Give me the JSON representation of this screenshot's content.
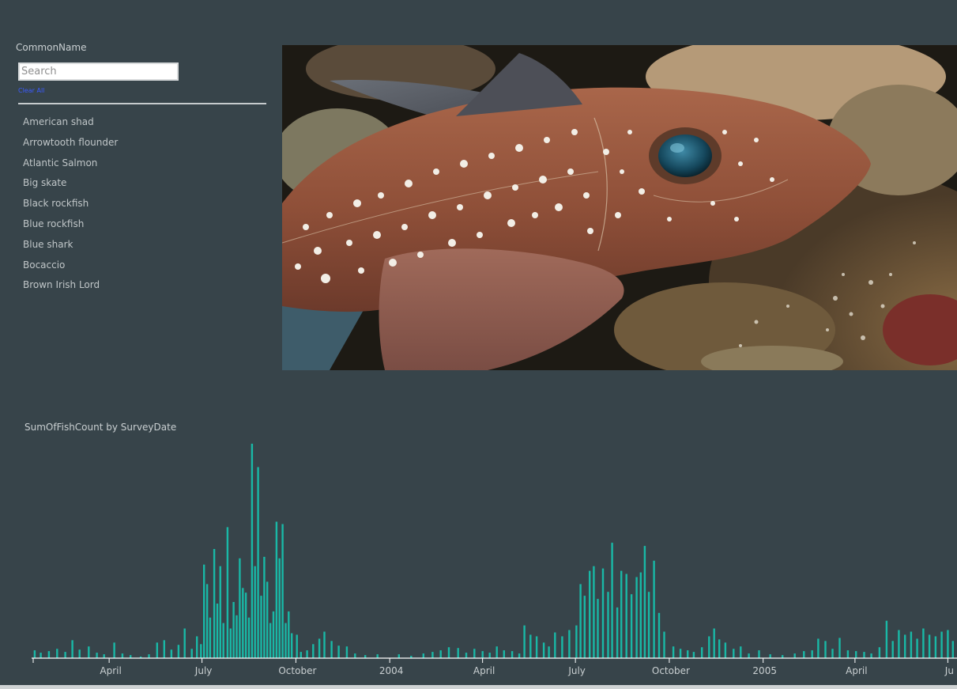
{
  "slicer": {
    "title": "CommonName",
    "search_placeholder": "Search",
    "clear_all_label": "Clear All",
    "items": [
      {
        "label": "American shad"
      },
      {
        "label": "Arrowtooth flounder"
      },
      {
        "label": "Atlantic Salmon"
      },
      {
        "label": "Big skate"
      },
      {
        "label": "Black rockfish"
      },
      {
        "label": "Blue rockfish"
      },
      {
        "label": "Blue shark"
      },
      {
        "label": "Bocaccio"
      },
      {
        "label": "Brown Irish Lord"
      }
    ]
  },
  "image": {
    "subject": "spotted-ratfish-photo"
  },
  "colors": {
    "background": "#37444a",
    "bar": "#19b8a6",
    "text": "#c9cfd1",
    "link": "#3b5bff"
  },
  "chart": {
    "title": "SumOfFishCount by SurveyDate"
  },
  "chart_data": {
    "type": "bar",
    "title": "SumOfFishCount by SurveyDate",
    "xlabel": "",
    "ylabel": "",
    "x_range": [
      "2003-01-15",
      "2005-07-10"
    ],
    "ylim": [
      0,
      280
    ],
    "grid": false,
    "ticks": [
      {
        "label": "April",
        "date": "2003-04-01"
      },
      {
        "label": "July",
        "date": "2003-07-01"
      },
      {
        "label": "October",
        "date": "2003-10-01"
      },
      {
        "label": "2004",
        "date": "2004-01-01"
      },
      {
        "label": "April",
        "date": "2004-04-01"
      },
      {
        "label": "July",
        "date": "2004-07-01"
      },
      {
        "label": "October",
        "date": "2004-10-01"
      },
      {
        "label": "2005",
        "date": "2005-01-01"
      },
      {
        "label": "April",
        "date": "2005-04-01"
      },
      {
        "label": "Ju",
        "date": "2005-07-01"
      }
    ],
    "series": [
      {
        "values": [
          [
            "2003-01-18",
            10
          ],
          [
            "2003-01-24",
            7
          ],
          [
            "2003-02-01",
            9
          ],
          [
            "2003-02-09",
            12
          ],
          [
            "2003-02-17",
            8
          ],
          [
            "2003-02-24",
            23
          ],
          [
            "2003-03-03",
            11
          ],
          [
            "2003-03-12",
            15
          ],
          [
            "2003-03-20",
            7
          ],
          [
            "2003-03-27",
            5
          ],
          [
            "2003-04-06",
            20
          ],
          [
            "2003-04-14",
            6
          ],
          [
            "2003-04-22",
            4
          ],
          [
            "2003-05-02",
            2
          ],
          [
            "2003-05-10",
            5
          ],
          [
            "2003-05-18",
            20
          ],
          [
            "2003-05-25",
            23
          ],
          [
            "2003-06-01",
            11
          ],
          [
            "2003-06-08",
            17
          ],
          [
            "2003-06-14",
            38
          ],
          [
            "2003-06-21",
            12
          ],
          [
            "2003-06-26",
            28
          ],
          [
            "2003-06-30",
            18
          ],
          [
            "2003-07-03",
            120
          ],
          [
            "2003-07-06",
            95
          ],
          [
            "2003-07-09",
            52
          ],
          [
            "2003-07-13",
            140
          ],
          [
            "2003-07-16",
            70
          ],
          [
            "2003-07-19",
            118
          ],
          [
            "2003-07-22",
            45
          ],
          [
            "2003-07-26",
            168
          ],
          [
            "2003-07-29",
            38
          ],
          [
            "2003-08-01",
            72
          ],
          [
            "2003-08-04",
            55
          ],
          [
            "2003-08-07",
            128
          ],
          [
            "2003-08-10",
            90
          ],
          [
            "2003-08-13",
            84
          ],
          [
            "2003-08-16",
            52
          ],
          [
            "2003-08-19",
            275
          ],
          [
            "2003-08-22",
            118
          ],
          [
            "2003-08-25",
            245
          ],
          [
            "2003-08-28",
            80
          ],
          [
            "2003-08-31",
            130
          ],
          [
            "2003-09-03",
            98
          ],
          [
            "2003-09-06",
            45
          ],
          [
            "2003-09-09",
            60
          ],
          [
            "2003-09-12",
            175
          ],
          [
            "2003-09-15",
            128
          ],
          [
            "2003-09-18",
            172
          ],
          [
            "2003-09-21",
            45
          ],
          [
            "2003-09-24",
            60
          ],
          [
            "2003-09-27",
            32
          ],
          [
            "2003-10-02",
            30
          ],
          [
            "2003-10-06",
            8
          ],
          [
            "2003-10-12",
            10
          ],
          [
            "2003-10-18",
            18
          ],
          [
            "2003-10-24",
            25
          ],
          [
            "2003-10-29",
            34
          ],
          [
            "2003-11-05",
            22
          ],
          [
            "2003-11-12",
            16
          ],
          [
            "2003-11-20",
            15
          ],
          [
            "2003-11-28",
            6
          ],
          [
            "2003-12-08",
            4
          ],
          [
            "2003-12-20",
            5
          ],
          [
            "2004-01-10",
            5
          ],
          [
            "2004-01-22",
            3
          ],
          [
            "2004-02-03",
            6
          ],
          [
            "2004-02-12",
            8
          ],
          [
            "2004-02-20",
            10
          ],
          [
            "2004-02-28",
            14
          ],
          [
            "2004-03-08",
            13
          ],
          [
            "2004-03-16",
            7
          ],
          [
            "2004-03-24",
            12
          ],
          [
            "2004-04-01",
            9
          ],
          [
            "2004-04-08",
            7
          ],
          [
            "2004-04-15",
            15
          ],
          [
            "2004-04-22",
            10
          ],
          [
            "2004-04-30",
            9
          ],
          [
            "2004-05-07",
            6
          ],
          [
            "2004-05-12",
            42
          ],
          [
            "2004-05-18",
            30
          ],
          [
            "2004-05-24",
            28
          ],
          [
            "2004-05-31",
            20
          ],
          [
            "2004-06-05",
            15
          ],
          [
            "2004-06-11",
            33
          ],
          [
            "2004-06-18",
            28
          ],
          [
            "2004-06-25",
            36
          ],
          [
            "2004-07-02",
            42
          ],
          [
            "2004-07-06",
            95
          ],
          [
            "2004-07-10",
            80
          ],
          [
            "2004-07-15",
            112
          ],
          [
            "2004-07-19",
            118
          ],
          [
            "2004-07-23",
            76
          ],
          [
            "2004-07-28",
            115
          ],
          [
            "2004-08-02",
            85
          ],
          [
            "2004-08-06",
            148
          ],
          [
            "2004-08-11",
            65
          ],
          [
            "2004-08-15",
            112
          ],
          [
            "2004-08-20",
            108
          ],
          [
            "2004-08-25",
            82
          ],
          [
            "2004-08-30",
            104
          ],
          [
            "2004-09-03",
            110
          ],
          [
            "2004-09-07",
            144
          ],
          [
            "2004-09-11",
            85
          ],
          [
            "2004-09-16",
            125
          ],
          [
            "2004-09-21",
            58
          ],
          [
            "2004-09-26",
            34
          ],
          [
            "2004-10-05",
            15
          ],
          [
            "2004-10-12",
            12
          ],
          [
            "2004-10-19",
            10
          ],
          [
            "2004-10-25",
            8
          ],
          [
            "2004-11-02",
            14
          ],
          [
            "2004-11-09",
            28
          ],
          [
            "2004-11-14",
            38
          ],
          [
            "2004-11-19",
            24
          ],
          [
            "2004-11-25",
            20
          ],
          [
            "2004-12-03",
            12
          ],
          [
            "2004-12-10",
            15
          ],
          [
            "2004-12-18",
            6
          ],
          [
            "2004-12-28",
            10
          ],
          [
            "2005-01-08",
            5
          ],
          [
            "2005-01-20",
            4
          ],
          [
            "2005-02-01",
            6
          ],
          [
            "2005-02-10",
            9
          ],
          [
            "2005-02-18",
            10
          ],
          [
            "2005-02-24",
            25
          ],
          [
            "2005-03-03",
            22
          ],
          [
            "2005-03-10",
            12
          ],
          [
            "2005-03-17",
            26
          ],
          [
            "2005-03-25",
            10
          ],
          [
            "2005-04-02",
            9
          ],
          [
            "2005-04-10",
            8
          ],
          [
            "2005-04-17",
            6
          ],
          [
            "2005-04-25",
            14
          ],
          [
            "2005-05-02",
            48
          ],
          [
            "2005-05-08",
            22
          ],
          [
            "2005-05-14",
            36
          ],
          [
            "2005-05-20",
            30
          ],
          [
            "2005-05-26",
            34
          ],
          [
            "2005-06-01",
            25
          ],
          [
            "2005-06-07",
            38
          ],
          [
            "2005-06-13",
            30
          ],
          [
            "2005-06-19",
            28
          ],
          [
            "2005-06-25",
            34
          ],
          [
            "2005-07-01",
            36
          ],
          [
            "2005-07-06",
            22
          ]
        ]
      }
    ]
  }
}
